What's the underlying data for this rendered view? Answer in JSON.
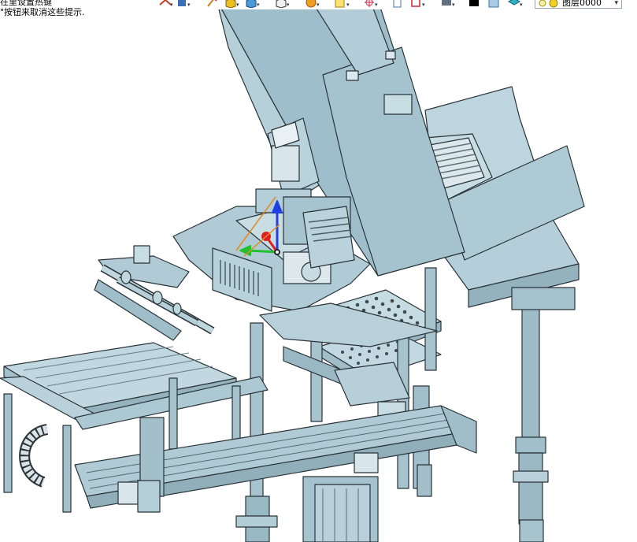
{
  "hint": {
    "line1": "在里设置热键",
    "line2": "\"按钮来取消这些提示."
  },
  "toolbar": {
    "icons": [
      "undo-icon",
      "paint-icon",
      "pencil-icon",
      "box-yellow-icon",
      "cube-blue-icon",
      "cube-white-icon",
      "sun-icon",
      "note-icon",
      "crosshair-icon",
      "page-icon",
      "frame-icon",
      "database-icon",
      "black-square-icon",
      "blue-square-icon",
      "layers-icon"
    ]
  },
  "layer": {
    "value": "图层0000"
  },
  "colors": {
    "part": "#a9c6d1",
    "edge": "#2a3338",
    "accent_red": "#e02020",
    "accent_green": "#20c030",
    "accent_blue": "#2040e0",
    "accent_orange": "#e08a20"
  }
}
